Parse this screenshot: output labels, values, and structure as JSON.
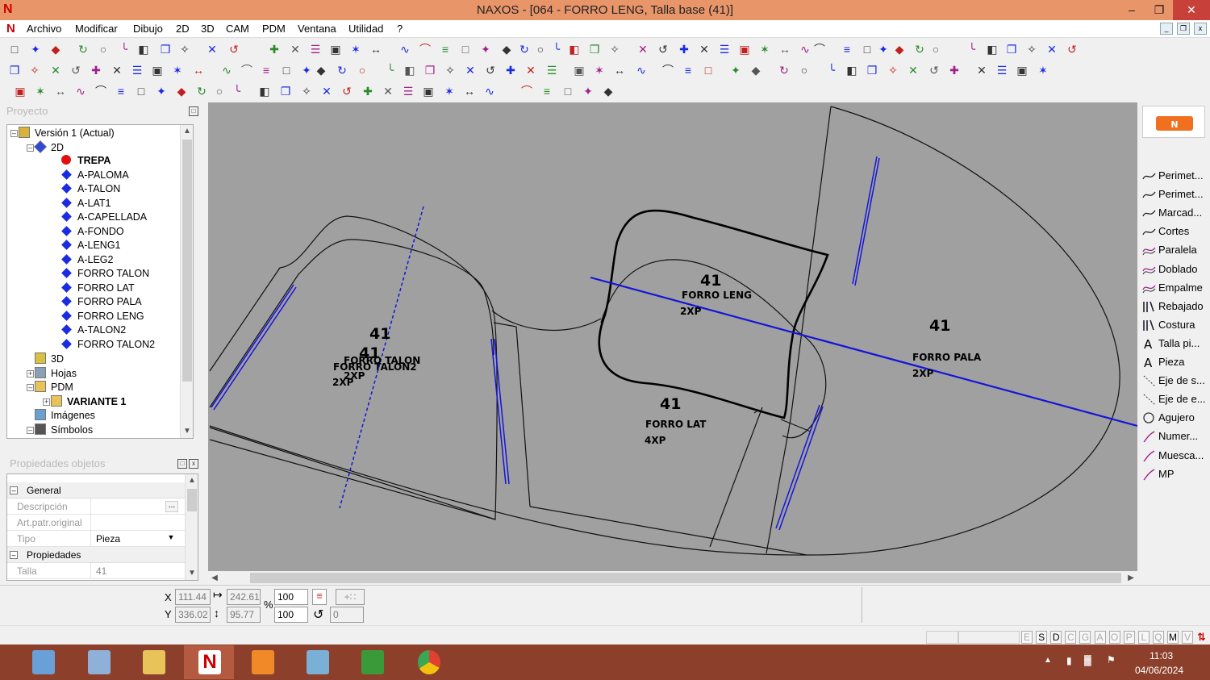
{
  "window": {
    "title": "NAXOS - [064 - FORRO LENG, Talla base (41)]",
    "minimize_icon": "minimize-icon",
    "restore_icon": "restore-icon",
    "close_icon": "close-icon"
  },
  "menu": {
    "items": [
      "Archivo",
      "Modificar",
      "Dibujo",
      "2D",
      "3D",
      "CAM",
      "PDM",
      "Ventana",
      "Utilidad",
      "?"
    ]
  },
  "proyecto_panel": {
    "title": "Proyecto",
    "tree": [
      {
        "label": "Versión 1 (Actual)",
        "icon": "project-icon",
        "bold": false
      },
      {
        "label": "2D",
        "icon": "2d-icon",
        "bold": false
      },
      {
        "label": "TREPA",
        "icon": "red-dot-icon",
        "bold": true
      },
      {
        "label": "A-PALOMA",
        "icon": "blue-diamond-icon",
        "bold": false
      },
      {
        "label": "A-TALON",
        "icon": "blue-diamond-icon",
        "bold": false
      },
      {
        "label": "A-LAT1",
        "icon": "blue-diamond-icon",
        "bold": false
      },
      {
        "label": "A-CAPELLADA",
        "icon": "blue-diamond-icon",
        "bold": false
      },
      {
        "label": "A-FONDO",
        "icon": "blue-diamond-icon",
        "bold": false
      },
      {
        "label": "A-LENG1",
        "icon": "blue-diamond-icon",
        "bold": false
      },
      {
        "label": "A-LEG2",
        "icon": "blue-diamond-icon",
        "bold": false
      },
      {
        "label": "FORRO TALON",
        "icon": "blue-diamond-icon",
        "bold": false
      },
      {
        "label": "FORRO LAT",
        "icon": "blue-diamond-icon",
        "bold": false
      },
      {
        "label": "FORRO PALA",
        "icon": "blue-diamond-icon",
        "bold": false
      },
      {
        "label": "FORRO LENG",
        "icon": "blue-diamond-icon",
        "bold": false
      },
      {
        "label": "A-TALON2",
        "icon": "blue-diamond-icon",
        "bold": false
      },
      {
        "label": "FORRO TALON2",
        "icon": "blue-diamond-icon",
        "bold": false
      },
      {
        "label": "3D",
        "icon": "3d-icon",
        "bold": false
      },
      {
        "label": "Hojas",
        "icon": "sheets-icon",
        "bold": false
      },
      {
        "label": "PDM",
        "icon": "folder-icon",
        "bold": false
      },
      {
        "label": "VARIANTE 1",
        "icon": "folder-open-icon",
        "bold": true
      },
      {
        "label": "Imágenes",
        "icon": "images-icon",
        "bold": false
      },
      {
        "label": "Símbolos",
        "icon": "symbols-icon",
        "bold": false
      }
    ]
  },
  "properties_panel": {
    "title": "Propiedades objetos",
    "groups": [
      {
        "label": "General",
        "rows": [
          {
            "name": "Descripción",
            "value": "",
            "has_button": true,
            "button_label": "..."
          },
          {
            "name": "Art.patr.original",
            "value": ""
          },
          {
            "name": "Tipo",
            "value": "Pieza",
            "dropdown": true
          }
        ]
      },
      {
        "label": "Propiedades",
        "rows": [
          {
            "name": "Talla",
            "value": "41"
          }
        ]
      }
    ]
  },
  "canvas": {
    "pieces": [
      {
        "size": "41",
        "name": "FORRO LENG",
        "qty": "2XP"
      },
      {
        "size": "41",
        "name": "FORRO TALON",
        "qty": "2XP"
      },
      {
        "size": "41",
        "name": "FORRO TALON2",
        "qty": "2XP"
      },
      {
        "size": "41",
        "name": "FORRO LAT",
        "qty": "4XP"
      },
      {
        "size": "41",
        "name": "FORRO PALA",
        "qty": "2XP"
      }
    ]
  },
  "right_tools": [
    {
      "label": "Perimet...",
      "icon": "perimeter-icon"
    },
    {
      "label": "Perimet...",
      "icon": "perimeter-icon"
    },
    {
      "label": "Marcad...",
      "icon": "marker-icon"
    },
    {
      "label": "Cortes",
      "icon": "cuts-icon"
    },
    {
      "label": "Paralela",
      "icon": "parallel-icon"
    },
    {
      "label": "Doblado",
      "icon": "fold-icon"
    },
    {
      "label": "Empalme",
      "icon": "splice-icon"
    },
    {
      "label": "Rebajado",
      "icon": "skive-icon"
    },
    {
      "label": "Costura",
      "icon": "seam-icon"
    },
    {
      "label": "Talla pi...",
      "icon": "text-a-icon"
    },
    {
      "label": "Pieza",
      "icon": "text-a-icon"
    },
    {
      "label": "Eje de s...",
      "icon": "axis-icon"
    },
    {
      "label": "Eje de e...",
      "icon": "axis-icon"
    },
    {
      "label": "Agujero",
      "icon": "hole-icon"
    },
    {
      "label": "Numer...",
      "icon": "numbering-icon"
    },
    {
      "label": "Muesca...",
      "icon": "notch-icon"
    },
    {
      "label": "MP",
      "icon": "mp-icon"
    }
  ],
  "coords": {
    "x_label": "X",
    "y_label": "Y",
    "x": "111.44",
    "y": "336.02",
    "width": "242.61",
    "height": "95.77",
    "scale_x": "100",
    "scale_y": "100",
    "percent": "%",
    "angle": "0"
  },
  "status_keys": [
    "E",
    "S",
    "D",
    "C",
    "G",
    "A",
    "O",
    "P",
    "L",
    "Q",
    "M",
    "V"
  ],
  "taskbar": {
    "time": "11:03",
    "date": "04/06/2024",
    "apps": [
      "calculator-icon",
      "explorer-icon",
      "folder-icon",
      "naxos-icon",
      "media-player-icon",
      "app-icon",
      "green-app-icon",
      "chrome-icon"
    ]
  }
}
